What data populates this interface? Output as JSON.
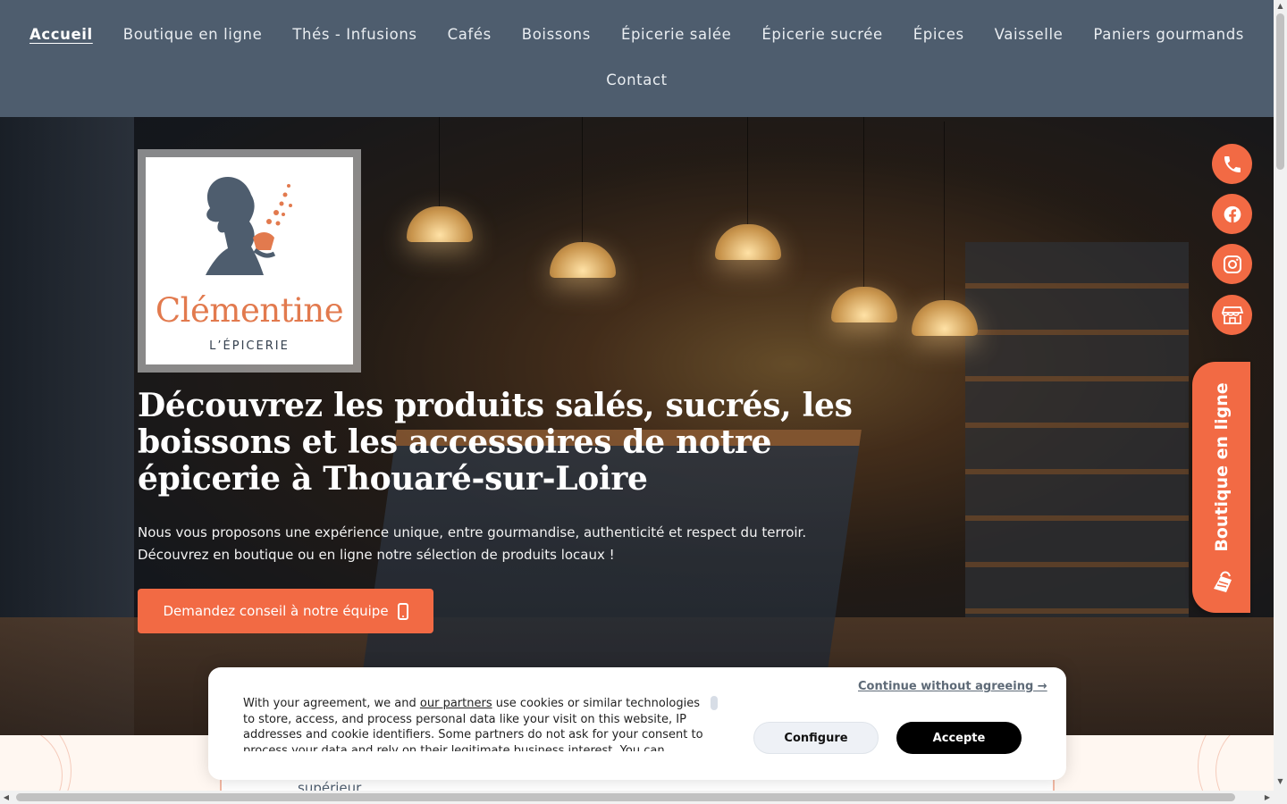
{
  "nav": {
    "items": [
      {
        "label": "Accueil",
        "active": true
      },
      {
        "label": "Boutique en ligne"
      },
      {
        "label": "Thés - Infusions"
      },
      {
        "label": "Cafés"
      },
      {
        "label": "Boissons"
      },
      {
        "label": "Épicerie salée"
      },
      {
        "label": "Épicerie sucrée"
      },
      {
        "label": "Épices"
      },
      {
        "label": "Vaisselle"
      },
      {
        "label": "Paniers gourmands"
      },
      {
        "label": "Contact"
      }
    ]
  },
  "logo": {
    "name": "Clémentine",
    "subtitle": "L’ÉPICERIE"
  },
  "hero": {
    "title": "Découvrez les produits salés, sucrés, les boissons et les accessoires de notre épicerie à Thouaré-sur-Loire",
    "text_line1": "Nous vous proposons une expérience unique, entre gourmandise, authenticité et respect du terroir.",
    "text_line2": "Découvrez en boutique ou en ligne notre sélection de produits locaux !",
    "cta_label": "Demandez conseil à notre équipe",
    "cta_icon": "smartphone-icon"
  },
  "floating": {
    "buttons": [
      "phone-icon",
      "facebook-icon",
      "instagram-icon",
      "store-icon"
    ],
    "side_tab_label": "Boutique en ligne",
    "side_tab_icon": "shopping-bag-icon"
  },
  "below": {
    "partial_text": "supérieur"
  },
  "cookie": {
    "text_before_link": "With your agreement, we and ",
    "link_label": "our partners",
    "text_after_link": " use cookies or similar technologies to store, access, and process personal data like your visit on this website, IP addresses and cookie identifiers. Some partners do not ask for your consent to process your data and rely on their legitimate business interest. You can",
    "continue_label": "Continue without agreeing →",
    "configure_label": "Configure",
    "accept_label": "Accepte"
  },
  "colors": {
    "nav_bg": "#4e5d6e",
    "accent": "#f26a44",
    "logo_orange": "#e27a4e",
    "logo_navy": "#34404e"
  }
}
